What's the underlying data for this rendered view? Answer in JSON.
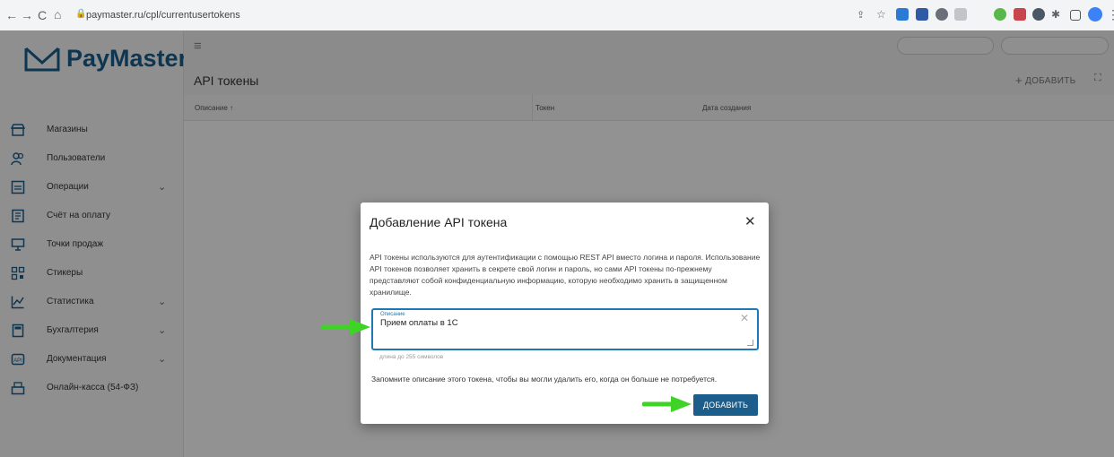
{
  "browser": {
    "url": "paymaster.ru/cpl/currentusertokens"
  },
  "app": {
    "logo_text": "PayMaster",
    "page_title": "API токены",
    "add_label": "ДОБАВИТЬ",
    "header_pills": [
      "",
      ""
    ]
  },
  "sidebar": {
    "items": [
      {
        "label": "Магазины",
        "icon": "store-icon",
        "chevron": false
      },
      {
        "label": "Пользователи",
        "icon": "users-icon",
        "chevron": false
      },
      {
        "label": "Операции",
        "icon": "operations-icon",
        "chevron": true
      },
      {
        "label": "Счёт на оплату",
        "icon": "invoice-icon",
        "chevron": false
      },
      {
        "label": "Точки продаж",
        "icon": "pos-icon",
        "chevron": false
      },
      {
        "label": "Стикеры",
        "icon": "qr-icon",
        "chevron": false
      },
      {
        "label": "Статистика",
        "icon": "chart-icon",
        "chevron": true
      },
      {
        "label": "Бухгалтерия",
        "icon": "calculator-icon",
        "chevron": true
      },
      {
        "label": "Документация",
        "icon": "api-icon",
        "chevron": true
      },
      {
        "label": "Онлайн-касса (54-ФЗ)",
        "icon": "cash-register-icon",
        "chevron": false
      }
    ]
  },
  "table": {
    "columns": [
      "Описание",
      "Токен",
      "Дата создания"
    ]
  },
  "modal": {
    "title": "Добавление API токена",
    "description": "API токены используются для аутентификации с помощью REST API вместо логина и пароля. Использование API токенов позволяет хранить в секрете свой логин и пароль, но сами API токены по-прежнему представляют собой конфиденциальную информацию, которую необходимо хранить в защищенном хранилище.",
    "field_label": "Описание",
    "field_value": "Прием оплаты в 1С",
    "field_hint": "длина до 255 символов",
    "remember_text": "Запомните описание этого токена, чтобы вы могли удалить его, когда он больше не потребуется.",
    "submit_label": "ДОБАВИТЬ"
  },
  "colors": {
    "brand": "#1b5e8c",
    "focus": "#1e78b4",
    "arrow": "#3fd326"
  }
}
